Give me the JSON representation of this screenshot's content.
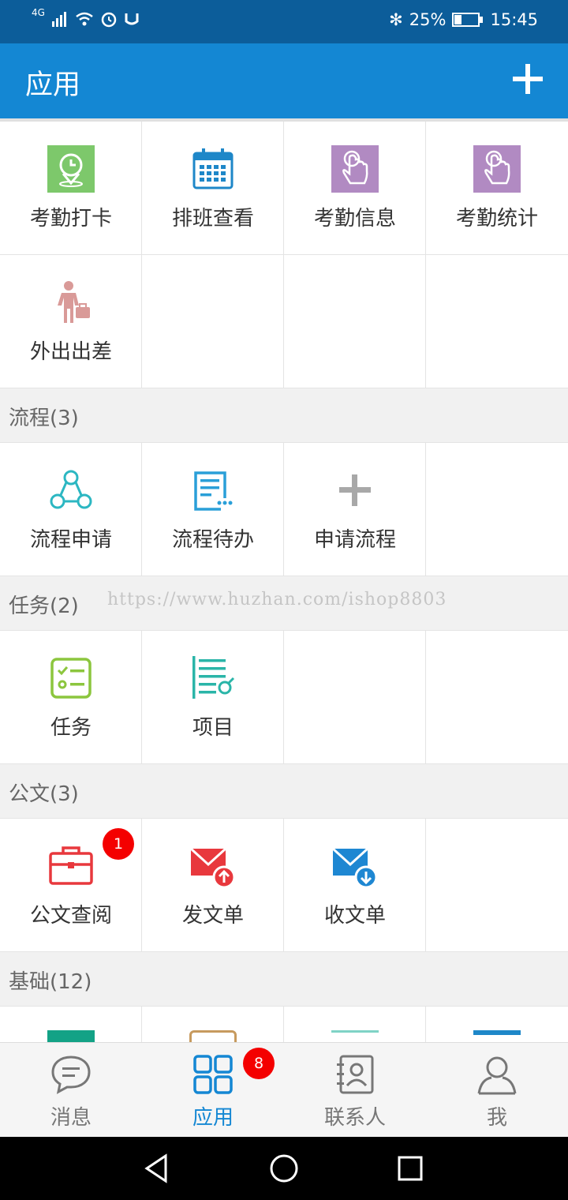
{
  "status_bar": {
    "signal": "4G",
    "battery": "25%",
    "time": "15:45"
  },
  "app_bar": {
    "title": "应用"
  },
  "attendance": [
    {
      "label": "考勤打卡",
      "icon": "location-clock-icon"
    },
    {
      "label": "排班查看",
      "icon": "calendar-icon"
    },
    {
      "label": "考勤信息",
      "icon": "hand-pointer-icon"
    },
    {
      "label": "考勤统计",
      "icon": "hand-pointer-icon"
    },
    {
      "label": "外出出差",
      "icon": "business-trip-icon"
    }
  ],
  "sections": {
    "flow": {
      "title": "流程(3)",
      "items": [
        {
          "label": "流程申请",
          "icon": "flow-nodes-icon"
        },
        {
          "label": "流程待办",
          "icon": "todo-document-icon"
        },
        {
          "label": "申请流程",
          "icon": "plus-icon"
        }
      ]
    },
    "task": {
      "title": "任务(2)",
      "items": [
        {
          "label": "任务",
          "icon": "checklist-icon"
        },
        {
          "label": "项目",
          "icon": "project-list-icon"
        }
      ]
    },
    "doc": {
      "title": "公文(3)",
      "items": [
        {
          "label": "公文查阅",
          "icon": "briefcase-icon",
          "badge": "1"
        },
        {
          "label": "发文单",
          "icon": "mail-send-icon"
        },
        {
          "label": "收文单",
          "icon": "mail-receive-icon"
        }
      ]
    },
    "base": {
      "title": "基础(12)"
    }
  },
  "watermark": "https://www.huzhan.com/ishop8803",
  "tabs": [
    {
      "label": "消息",
      "icon": "chat-bubble-icon"
    },
    {
      "label": "应用",
      "icon": "apps-grid-icon",
      "badge": "8",
      "active": true
    },
    {
      "label": "联系人",
      "icon": "contacts-icon"
    },
    {
      "label": "我",
      "icon": "person-icon"
    }
  ],
  "colors": {
    "status_bar": "#0c5d9a",
    "app_bar": "#1487d3",
    "badge": "#f40000",
    "active_tab": "#1487d3"
  }
}
